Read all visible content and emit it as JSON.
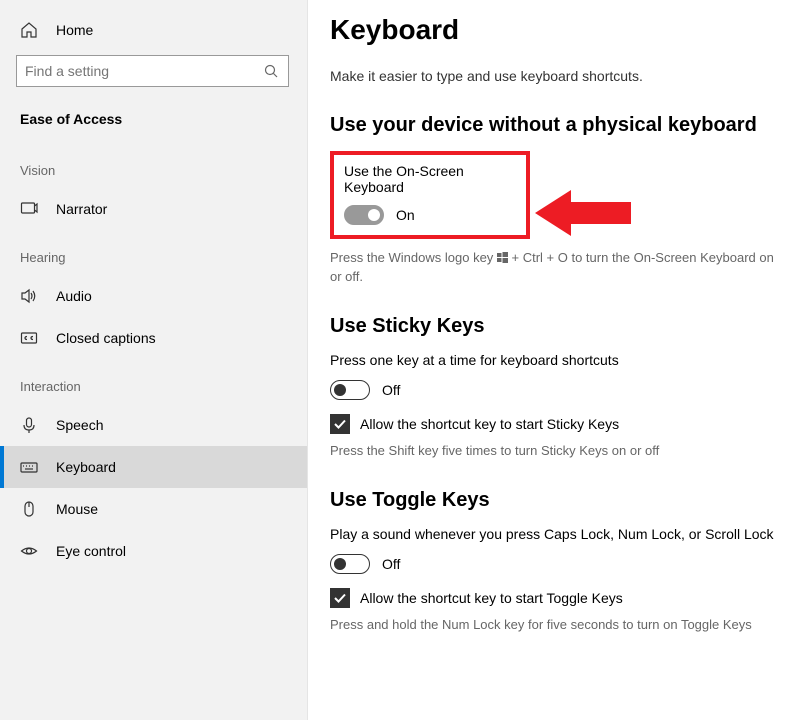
{
  "sidebar": {
    "home": "Home",
    "searchPlaceholder": "Find a setting",
    "sectionTitle": "Ease of Access",
    "groups": [
      {
        "label": "Vision",
        "items": [
          {
            "label": "Narrator"
          }
        ]
      },
      {
        "label": "Hearing",
        "items": [
          {
            "label": "Audio"
          },
          {
            "label": "Closed captions"
          }
        ]
      },
      {
        "label": "Interaction",
        "items": [
          {
            "label": "Speech"
          },
          {
            "label": "Keyboard"
          },
          {
            "label": "Mouse"
          },
          {
            "label": "Eye control"
          }
        ]
      }
    ]
  },
  "page": {
    "title": "Keyboard",
    "subtitle": "Make it easier to type and use keyboard shortcuts.",
    "osk": {
      "heading": "Use your device without a physical keyboard",
      "label": "Use the On-Screen Keyboard",
      "state": "On",
      "hintPre": "Press the Windows logo key ",
      "hintPost": " + Ctrl + O to turn the On-Screen Keyboard on or off."
    },
    "sticky": {
      "heading": "Use Sticky Keys",
      "desc": "Press one key at a time for keyboard shortcuts",
      "state": "Off",
      "check": "Allow the shortcut key to start Sticky Keys",
      "hint": "Press the Shift key five times to turn Sticky Keys on or off"
    },
    "toggle": {
      "heading": "Use Toggle Keys",
      "desc": "Play a sound whenever you press Caps Lock, Num Lock, or Scroll Lock",
      "state": "Off",
      "check": "Allow the shortcut key to start Toggle Keys",
      "hint": "Press and hold the Num Lock key for five seconds to turn on Toggle Keys"
    }
  }
}
